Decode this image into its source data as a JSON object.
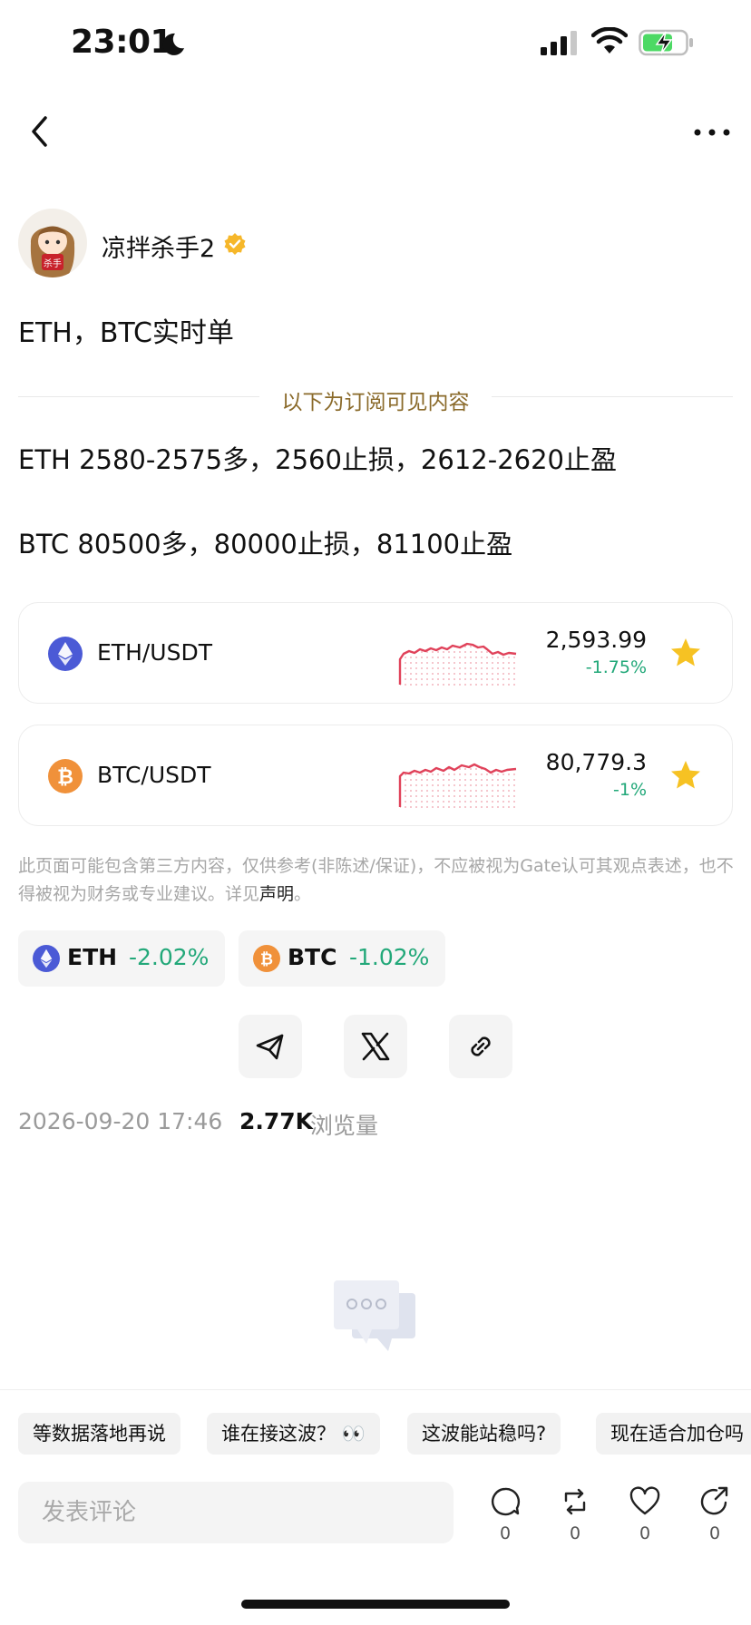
{
  "status_bar": {
    "time": "23:01"
  },
  "author": {
    "name": "凉拌杀手2",
    "avatar_text": "杀手"
  },
  "post": {
    "title": "ETH，BTC实时单",
    "subscription_label": "以下为订阅可见内容",
    "lines": [
      "ETH 2580-2575多，2560止损，2612-2620止盈",
      "BTC 80500多，80000止损，81100止盈"
    ]
  },
  "tickers": [
    {
      "pair": "ETH/USDT",
      "price": "2,593.99",
      "change": "-1.75%",
      "icon": "ethereum-icon"
    },
    {
      "pair": "BTC/USDT",
      "price": "80,779.3",
      "change": "-1%",
      "icon": "bitcoin-icon"
    }
  ],
  "disclaimer": {
    "text": "此页面可能包含第三方内容，仅供参考(非陈述/保证)，不应被视为Gate认可其观点表述，也不得被视为财务或专业建议。详见",
    "link": "声明",
    "end": "。"
  },
  "coin_chips": [
    {
      "symbol": "ETH",
      "change": "-2.02%"
    },
    {
      "symbol": "BTC",
      "change": "-1.02%"
    }
  ],
  "share": [
    "telegram-icon",
    "x-icon",
    "link-icon"
  ],
  "meta": {
    "date": "2026-09-20 17:46",
    "views": "2.77K",
    "views_label": "浏览量"
  },
  "suggestions": [
    "等数据落地再说",
    "谁在接这波？ 👀",
    "这波能站稳吗?",
    "现在适合加仓吗"
  ],
  "comment_box": {
    "placeholder": "发表评论"
  },
  "actions": [
    {
      "name": "comment",
      "count": "0"
    },
    {
      "name": "repost",
      "count": "0"
    },
    {
      "name": "like",
      "count": "0"
    },
    {
      "name": "share",
      "count": "0"
    }
  ],
  "colors": {
    "positive": "#22a879",
    "sparkline": "#e0425a",
    "subscription_label": "#8a6a2a",
    "star": "#f6c223"
  }
}
